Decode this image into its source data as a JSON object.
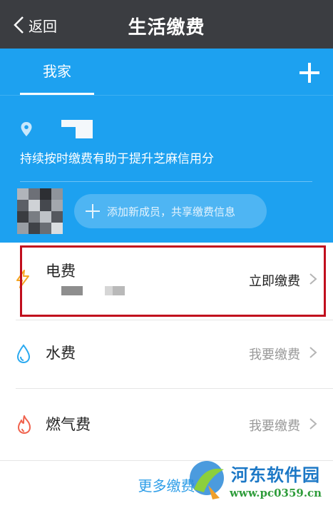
{
  "nav": {
    "back_label": "返回",
    "title": "生活缴费"
  },
  "header": {
    "tab_home": "我家"
  },
  "family": {
    "tip": "持续按时缴费有助于提升芝麻信用分",
    "add_member": "添加新成员，共享缴费信息"
  },
  "bills": [
    {
      "name": "电费",
      "action": "立即缴费",
      "icon": "lightning-icon",
      "action_color": "#222222"
    },
    {
      "name": "水费",
      "action": "我要缴费",
      "icon": "water-drop-icon",
      "action_color": "#999999"
    },
    {
      "name": "燃气费",
      "action": "我要缴费",
      "icon": "flame-icon",
      "action_color": "#999999"
    }
  ],
  "more_label": "更多缴费",
  "watermark": {
    "title": "河东软件园",
    "url": "www.pc0359.cn"
  },
  "colors": {
    "nav_bg": "#3b3d41",
    "header_bg": "#1da1f0",
    "highlight": "#c10e1d",
    "link": "#2f9ee8"
  }
}
